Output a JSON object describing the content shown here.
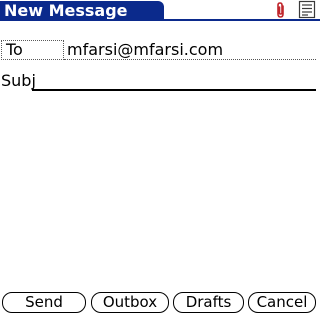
{
  "header": {
    "title": "New Message",
    "attachment_icon": "paperclip-icon",
    "details_icon": "details-icon"
  },
  "compose": {
    "to_label": "To",
    "to_value": "mfarsi@mfarsi.com",
    "subject_label": "Subj",
    "subject_value": "",
    "body_text": ""
  },
  "buttons": {
    "send": "Send",
    "outbox": "Outbox",
    "drafts": "Drafts",
    "cancel": "Cancel"
  },
  "colors": {
    "title_bar": "#0b2a8c",
    "attachment_icon": "#c0262c"
  }
}
